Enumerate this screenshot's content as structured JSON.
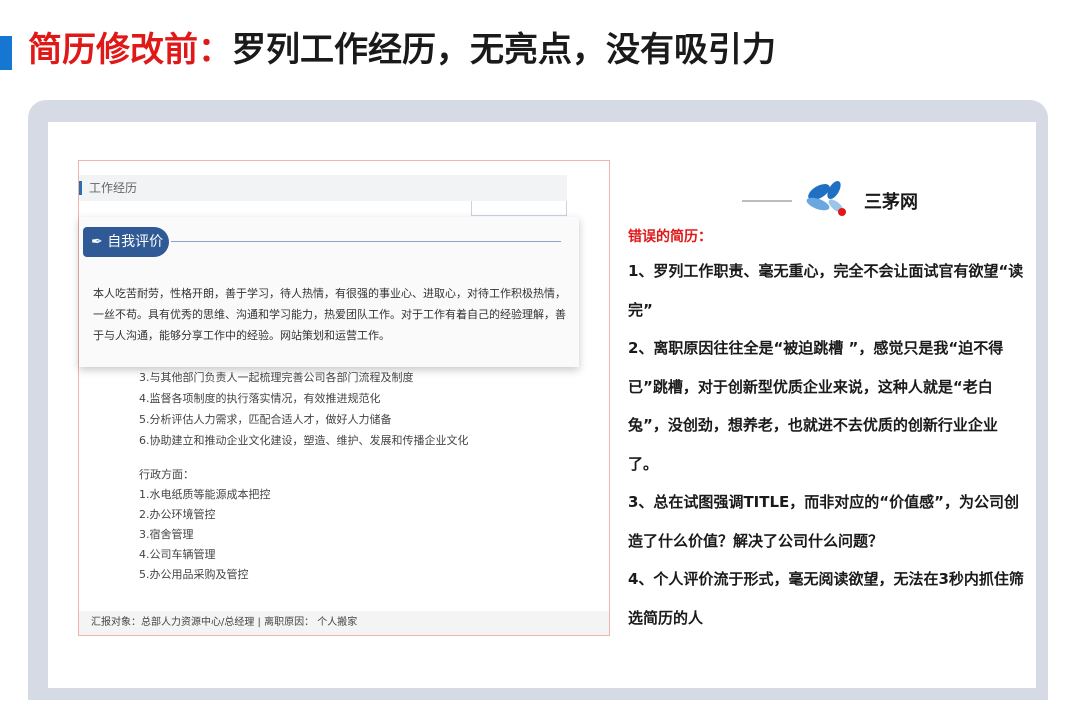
{
  "heading": {
    "red_part": "简历修改前：",
    "black_part": "罗列工作经历，无亮点，没有吸引力"
  },
  "resume": {
    "work_section_label": "工作经历",
    "self_eval_label": "自我评价",
    "self_eval_text": "本人吃苦耐劳，性格开朗，善于学习，待人热情，有很强的事业心、进取心，对待工作积极热情，一丝不苟。具有优秀的思维、沟通和学习能力，热爱团队工作。对于工作有着自己的经验理解，善于与人沟通，能够分享工作中的经验。网站策划和运营工作。",
    "hr_items": [
      "3.与其他部门负责人一起梳理完善公司各部门流程及制度",
      "4.监督各项制度的执行落实情况，有效推进规范化",
      "5.分析评估人力需求，匹配合适人才，做好人力储备",
      "6.协助建立和推动企业文化建设，塑造、维护、发展和传播企业文化"
    ],
    "admin_heading": "行政方面：",
    "admin_items": [
      "1.水电纸质等能源成本把控",
      "2.办公环境管控",
      "3.宿舍管理",
      "4.公司车辆管理",
      "5.办公用品采购及管控"
    ],
    "footer": "汇报对象：总部人力资源中心/总经理  |  离职原因：  个人搬家"
  },
  "brand": {
    "name": "三茅网",
    "colors": {
      "blue": "#1f6fc2",
      "red": "#e01818"
    },
    "icon": "dragonfly-logo-icon"
  },
  "analysis": {
    "title": "错误的简历：",
    "items": [
      "1、罗列工作职责、毫无重心，完全不会让面试官有欲望“读完”",
      "2、离职原因往往全是“被迫跳槽 ”，感觉只是我“迫不得已”跳槽，对于创新型优质企业来说，这种人就是“老白兔”，没创劲，想养老，也就进不去优质的创新行业企业了。",
      "3、总在试图强调TITLE，而非对应的“价值感”，为公司创造了什么价值？解决了公司什么问题？",
      "4、个人评价流于形式，毫无阅读欲望，无法在3秒内抓住筛选简历的人"
    ]
  }
}
